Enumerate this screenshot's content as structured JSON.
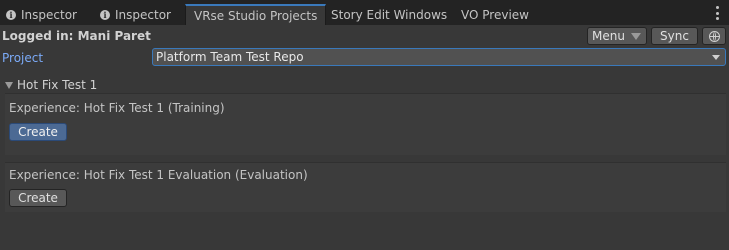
{
  "tabs": [
    {
      "label": "Inspector",
      "icon": "info-icon",
      "active": false
    },
    {
      "label": "Inspector",
      "icon": "info-icon",
      "active": false
    },
    {
      "label": "VRse Studio Projects",
      "active": true
    },
    {
      "label": "Story Edit Windows",
      "active": false
    },
    {
      "label": "VO Preview",
      "active": false
    }
  ],
  "header": {
    "logged_in": "Logged in: Mani Paret",
    "menu_label": "Menu",
    "sync_label": "Sync"
  },
  "project": {
    "label": "Project",
    "selected": "Platform Team Test Repo"
  },
  "foldout": {
    "title": "Hot Fix Test 1",
    "expanded": true
  },
  "experiences": [
    {
      "label": "Experience: Hot Fix Test 1 (Training)",
      "button": "Create",
      "highlighted": true
    },
    {
      "label": "Experience: Hot Fix Test 1 Evaluation (Evaluation)",
      "button": "Create",
      "highlighted": false
    }
  ],
  "colors": {
    "accent": "#3a79bb",
    "project_label": "#7baaf7",
    "background": "#383838"
  }
}
